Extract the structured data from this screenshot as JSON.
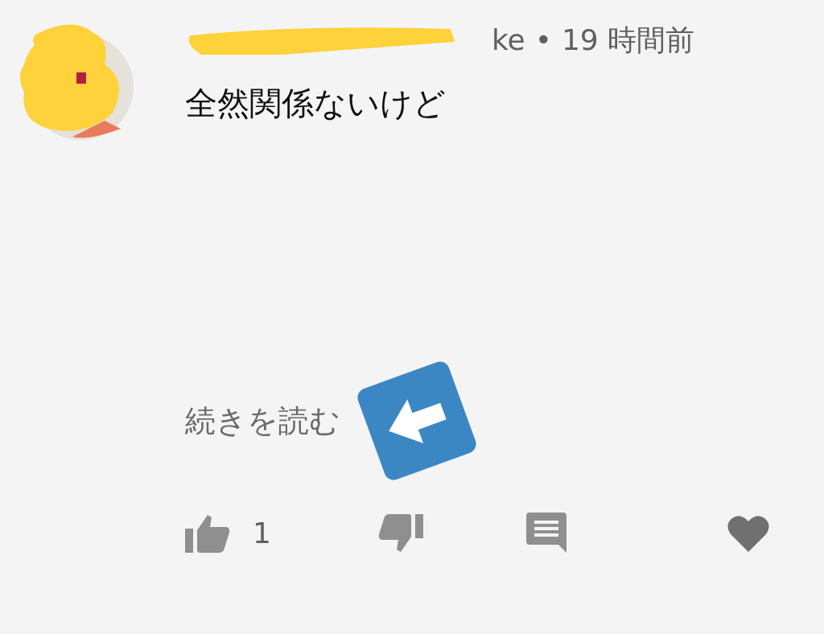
{
  "comment": {
    "author_visible": "ke",
    "separator": "•",
    "time": "19 時間前",
    "text": "全然関係ないけど",
    "read_more": "続きを読む"
  },
  "actions": {
    "like_count": "1"
  }
}
